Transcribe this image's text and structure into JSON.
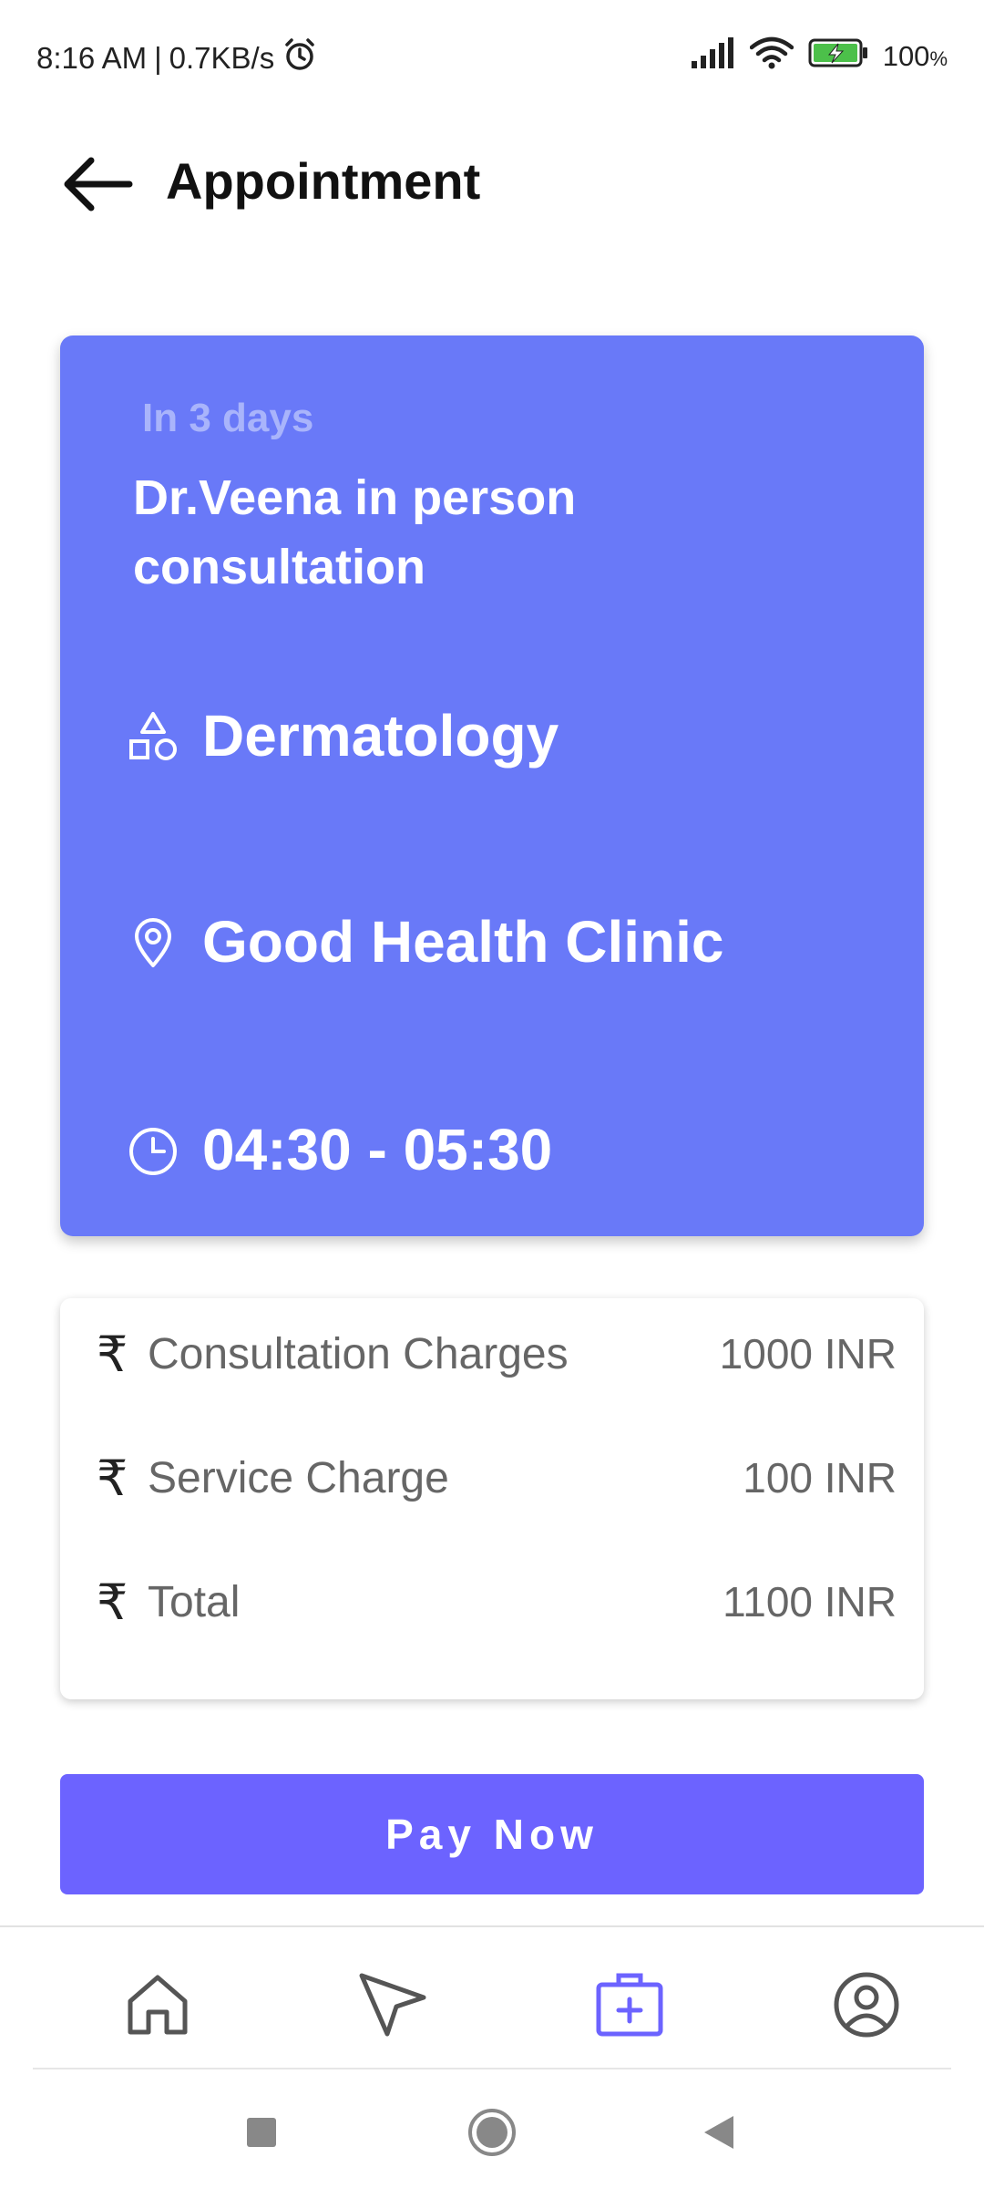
{
  "status_bar": {
    "time": "8:16 AM",
    "separator": "|",
    "network_speed": "0.7KB/s",
    "battery": "100",
    "battery_unit": "%",
    "icons": [
      "alarm-icon",
      "signal-icon",
      "wifi-icon",
      "battery-icon"
    ]
  },
  "header": {
    "title": "Appointment",
    "back_icon": "arrow-left-icon"
  },
  "appointment": {
    "relative_date": "In 3 days",
    "title": "Dr.Veena in person consultation",
    "specialty": "Dermatology",
    "clinic": "Good Health Clinic",
    "time_slot": "04:30 - 05:30",
    "card_color": "#6979f8"
  },
  "charges": {
    "currency_symbol": "₹",
    "rows": [
      {
        "label": "Consultation Charges",
        "value": "1000 INR"
      },
      {
        "label": "Service Charge",
        "value": "100 INR"
      },
      {
        "label": "Total",
        "value": "1100 INR"
      }
    ]
  },
  "pay_button": {
    "label": "Pay Now",
    "color": "#6c63ff"
  },
  "bottom_nav": {
    "items": [
      {
        "name": "home",
        "icon": "home-icon",
        "active": false
      },
      {
        "name": "navigate",
        "icon": "navigation-arrow-icon",
        "active": false
      },
      {
        "name": "appointments",
        "icon": "medical-kit-icon",
        "active": true
      },
      {
        "name": "profile",
        "icon": "user-circle-icon",
        "active": false
      }
    ],
    "active_color": "#6c63ff",
    "inactive_color": "#555555"
  },
  "system_nav": {
    "icons": [
      "square-recents-icon",
      "circle-home-icon",
      "triangle-back-icon"
    ]
  }
}
